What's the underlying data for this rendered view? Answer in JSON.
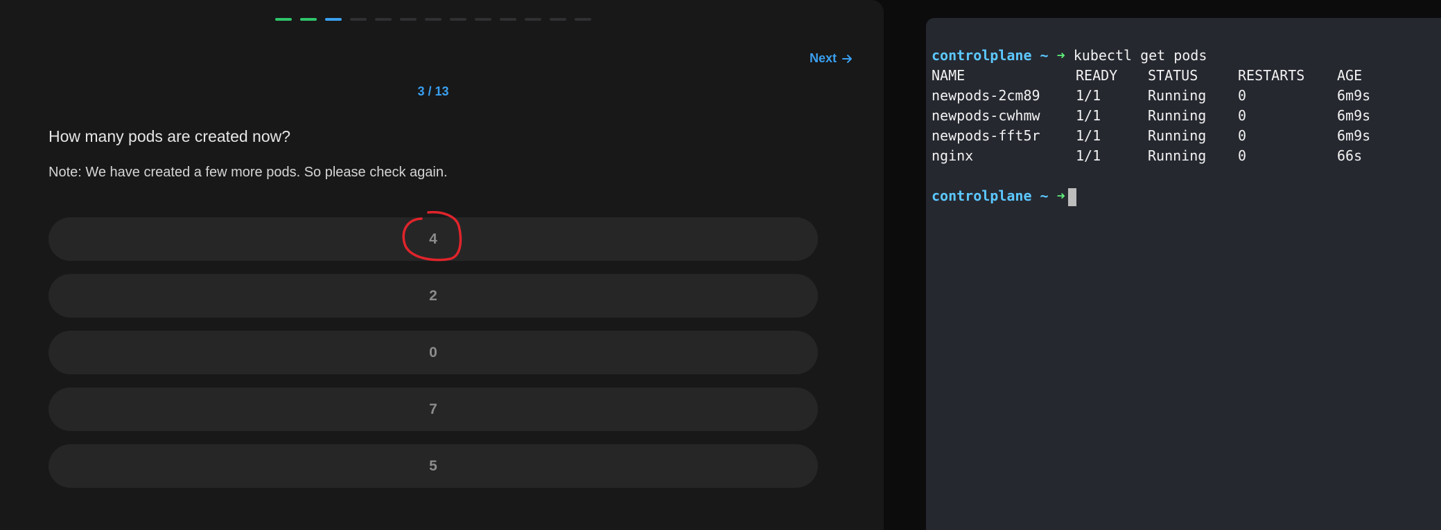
{
  "quiz": {
    "progress": {
      "current": 3,
      "total": 13,
      "completed": 2
    },
    "next_label": "Next",
    "counter": "3 / 13",
    "question": "How many pods are created now?",
    "note": "Note: We have created a few more pods. So please check again.",
    "options": [
      "4",
      "2",
      "0",
      "7",
      "5"
    ],
    "annotated_option": "4",
    "colors": {
      "done": "#2fc46a",
      "current": "#3aa0f0",
      "annotation": "#e0242b"
    }
  },
  "terminal": {
    "prompt_host": "controlplane",
    "prompt_tilde": "~",
    "prompt_arrow": "➜",
    "command": "kubectl get pods",
    "headers": [
      "NAME",
      "READY",
      "STATUS",
      "RESTARTS",
      "AGE"
    ],
    "rows": [
      [
        "newpods-2cm89",
        "1/1",
        "Running",
        "0",
        "6m9s"
      ],
      [
        "newpods-cwhmw",
        "1/1",
        "Running",
        "0",
        "6m9s"
      ],
      [
        "newpods-fft5r",
        "1/1",
        "Running",
        "0",
        "6m9s"
      ],
      [
        "nginx",
        "1/1",
        "Running",
        "0",
        "66s"
      ]
    ]
  }
}
